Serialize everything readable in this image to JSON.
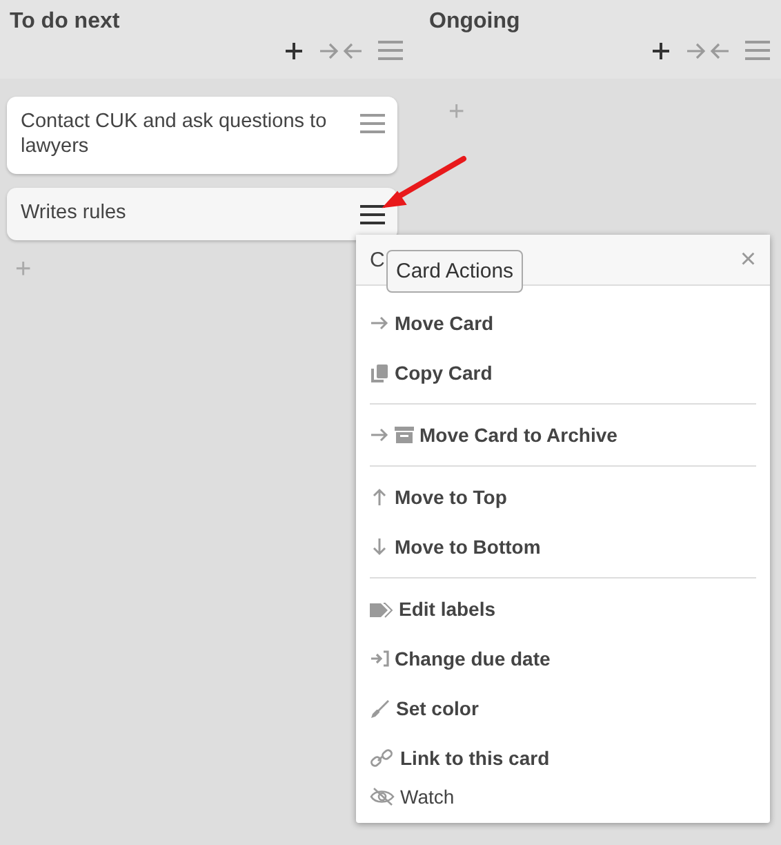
{
  "lists": [
    {
      "title": "To do next",
      "add": "+",
      "cards": [
        {
          "text": "Contact CUK and ask questions to lawyers",
          "highlighted": false
        },
        {
          "text": "Writes rules",
          "highlighted": true
        }
      ]
    },
    {
      "title": "Ongoing",
      "add": "+"
    }
  ],
  "popup": {
    "title": "C",
    "close": "×",
    "tooltip": "Card Actions",
    "groups": [
      {
        "items": [
          {
            "label": "Move Card",
            "kind": "move"
          },
          {
            "label": "Copy Card",
            "kind": "copy"
          }
        ]
      },
      {
        "items": [
          {
            "label": "Move Card to Archive",
            "kind": "archive"
          }
        ]
      },
      {
        "items": [
          {
            "label": "Move to Top",
            "kind": "top"
          },
          {
            "label": "Move to Bottom",
            "kind": "bottom"
          }
        ]
      },
      {
        "items": [
          {
            "label": "Edit labels",
            "kind": "labels"
          },
          {
            "label": "Change due date",
            "kind": "due"
          },
          {
            "label": "Set color",
            "kind": "color"
          },
          {
            "label": "Link to this card",
            "kind": "link"
          },
          {
            "label": "Watch",
            "kind": "watch"
          }
        ]
      }
    ]
  }
}
